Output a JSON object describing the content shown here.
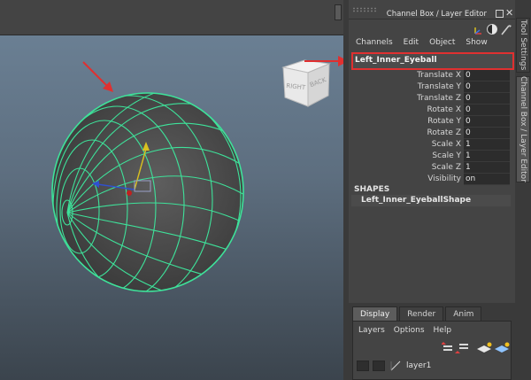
{
  "panel": {
    "title": "Channel Box / Layer Editor",
    "menu": [
      "Channels",
      "Edit",
      "Object",
      "Show"
    ]
  },
  "side_tabs": {
    "tool_settings": "Tool Settings",
    "channel_box": "Channel Box / Layer Editor"
  },
  "view_cube": {
    "face_front": "RIGHT",
    "face_side": "BACK"
  },
  "channel_box": {
    "object_name": "Left_Inner_Eyeball",
    "attributes": [
      {
        "label": "Translate X",
        "value": "0"
      },
      {
        "label": "Translate Y",
        "value": "0"
      },
      {
        "label": "Translate Z",
        "value": "0"
      },
      {
        "label": "Rotate X",
        "value": "0"
      },
      {
        "label": "Rotate Y",
        "value": "0"
      },
      {
        "label": "Rotate Z",
        "value": "0"
      },
      {
        "label": "Scale X",
        "value": "1"
      },
      {
        "label": "Scale Y",
        "value": "1"
      },
      {
        "label": "Scale Z",
        "value": "1"
      },
      {
        "label": "Visibility",
        "value": "on"
      }
    ],
    "shapes_header": "SHAPES",
    "shape_name": "Left_Inner_EyeballShape"
  },
  "layer_editor": {
    "tabs": [
      "Display",
      "Render",
      "Anim"
    ],
    "active_tab": "Display",
    "menu": [
      "Layers",
      "Options",
      "Help"
    ],
    "layer_name": "layer1"
  },
  "colors": {
    "wireframe": "#3ee29a",
    "annotation": "#e03030",
    "axis_y": "#d8c020",
    "axis_x": "#3050d0",
    "axis_center": "#c02020"
  }
}
